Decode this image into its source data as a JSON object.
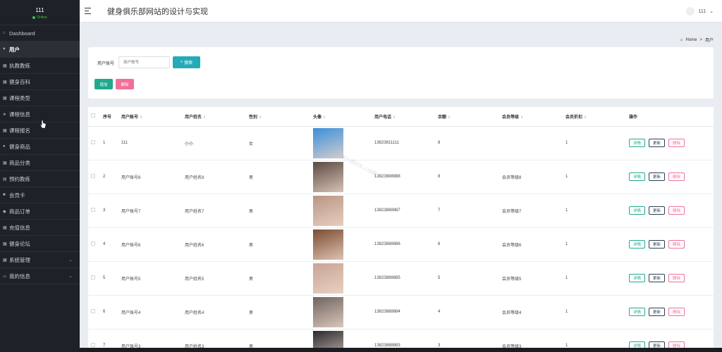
{
  "sidebar": {
    "user_name": "111",
    "status": "Online",
    "items": [
      {
        "label": "Dashboard",
        "icon": "home-icon",
        "glyph": "⌂"
      },
      {
        "label": "用户",
        "icon": "heart-icon",
        "glyph": "♥"
      },
      {
        "label": "执教教练",
        "icon": "grid-icon",
        "glyph": "▦"
      },
      {
        "label": "健身百科",
        "icon": "grid-icon",
        "glyph": "▦"
      },
      {
        "label": "课程类型",
        "icon": "grid-icon",
        "glyph": "▦"
      },
      {
        "label": "课程信息",
        "icon": "send-icon",
        "glyph": "➤"
      },
      {
        "label": "课程报名",
        "icon": "grid-icon",
        "glyph": "▦"
      },
      {
        "label": "健身商品",
        "icon": "user-icon",
        "glyph": "●"
      },
      {
        "label": "商品分类",
        "icon": "grid-icon",
        "glyph": "▦"
      },
      {
        "label": "预约教练",
        "icon": "calendar-icon",
        "glyph": "▤"
      },
      {
        "label": "会员卡",
        "icon": "card-icon",
        "glyph": "■"
      },
      {
        "label": "商品订单",
        "icon": "diamond-icon",
        "glyph": "◆"
      },
      {
        "label": "充值信息",
        "icon": "grid-icon",
        "glyph": "▦"
      },
      {
        "label": "健身论坛",
        "icon": "grid-icon",
        "glyph": "▦"
      },
      {
        "label": "系统管理",
        "icon": "grid-icon",
        "glyph": "▦"
      },
      {
        "label": "我的信息",
        "icon": "folder-icon",
        "glyph": "▭"
      }
    ]
  },
  "header": {
    "title": "健身俱乐部网站的设计与实现",
    "user": "111"
  },
  "breadcrumb": {
    "home": "Home",
    "separator": ">",
    "current": "用户"
  },
  "search": {
    "label": "用户账号",
    "placeholder": "用户账号",
    "button": "搜索"
  },
  "actions": {
    "add": "增加",
    "delete": "删除"
  },
  "table": {
    "headers": [
      "",
      "序号",
      "用户账号",
      "用户姓名",
      "性别",
      "头像",
      "用户电话",
      "余额",
      "会员等级",
      "会员折扣",
      "操作"
    ],
    "ops": {
      "detail": "详情",
      "edit": "更新",
      "remove": "删除"
    },
    "rows": [
      {
        "no": "1",
        "account": "111",
        "name": "小小",
        "gender": "女",
        "avatar_color": "#3b8fd9",
        "phone": "13823811111",
        "balance": "8",
        "level": "",
        "discount": "1"
      },
      {
        "no": "2",
        "account": "用户账号8",
        "name": "用户姓名8",
        "gender": "男",
        "avatar_color": "#5a4a42",
        "phone": "13823888888",
        "balance": "8",
        "level": "会员等级8",
        "discount": "1"
      },
      {
        "no": "3",
        "account": "用户账号7",
        "name": "用户姓名7",
        "gender": "男",
        "avatar_color": "#b99683",
        "phone": "13823888887",
        "balance": "7",
        "level": "会员等级7",
        "discount": "1"
      },
      {
        "no": "4",
        "account": "用户账号6",
        "name": "用户姓名6",
        "gender": "男",
        "avatar_color": "#7b4c32",
        "phone": "13823888886",
        "balance": "6",
        "level": "会员等级6",
        "discount": "1"
      },
      {
        "no": "5",
        "account": "用户账号5",
        "name": "用户姓名5",
        "gender": "男",
        "avatar_color": "#c8a493",
        "phone": "13823888885",
        "balance": "5",
        "level": "会员等级5",
        "discount": "1"
      },
      {
        "no": "6",
        "account": "用户账号4",
        "name": "用户姓名4",
        "gender": "男",
        "avatar_color": "#6e6460",
        "phone": "13823888884",
        "balance": "4",
        "level": "会员等级4",
        "discount": "1"
      },
      {
        "no": "7",
        "account": "用户账号3",
        "name": "用户姓名3",
        "gender": "男",
        "avatar_color": "#2a2a30",
        "phone": "13823888883",
        "balance": "3",
        "level": "会员等级3",
        "discount": "1"
      }
    ]
  },
  "watermark": "加入我的私人收藏"
}
